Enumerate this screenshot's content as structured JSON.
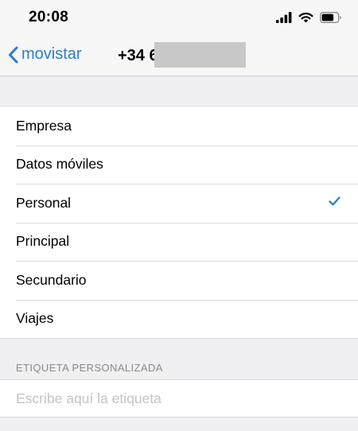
{
  "status_bar": {
    "time": "20:08"
  },
  "nav": {
    "back_label": "movistar",
    "title": "+34 6"
  },
  "labels": [
    {
      "text": "Empresa",
      "selected": false
    },
    {
      "text": "Datos móviles",
      "selected": false
    },
    {
      "text": "Personal",
      "selected": true
    },
    {
      "text": "Principal",
      "selected": false
    },
    {
      "text": "Secundario",
      "selected": false
    },
    {
      "text": "Viajes",
      "selected": false
    }
  ],
  "custom_label": {
    "header": "ETIQUETA PERSONALIZADA",
    "placeholder": "Escribe aquí la etiqueta",
    "value": ""
  },
  "colors": {
    "accent": "#2b7cd3",
    "background": "#efeff4"
  }
}
